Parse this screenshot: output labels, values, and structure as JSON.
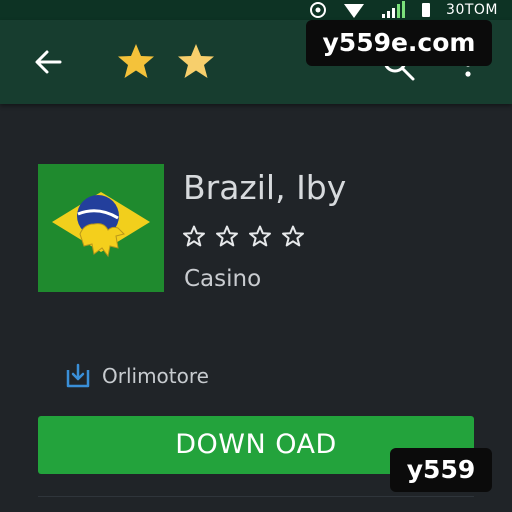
{
  "status_bar": {
    "time": "30TOM",
    "icons": [
      "sync-icon",
      "wifi-icon",
      "signal-icon",
      "battery-icon"
    ]
  },
  "toolbar": {
    "back_icon": "arrow-left-icon",
    "stars": 2,
    "star_color": "#f4c23a",
    "search_icon": "search-icon",
    "more_icon": "more-vert-icon",
    "background": "#173d2f"
  },
  "watermark": {
    "top": "y559e.com",
    "bottom": "y559"
  },
  "app": {
    "icon": "brazil-flag-icon",
    "title": "Brazil, Iby",
    "rating_stars": 4,
    "rating_filled": 0,
    "category": "Casino"
  },
  "developer": {
    "icon": "download-icon",
    "name": "Orlimotore"
  },
  "actions": {
    "download_label": "DOWN OAD",
    "download_color": "#23a33c"
  }
}
